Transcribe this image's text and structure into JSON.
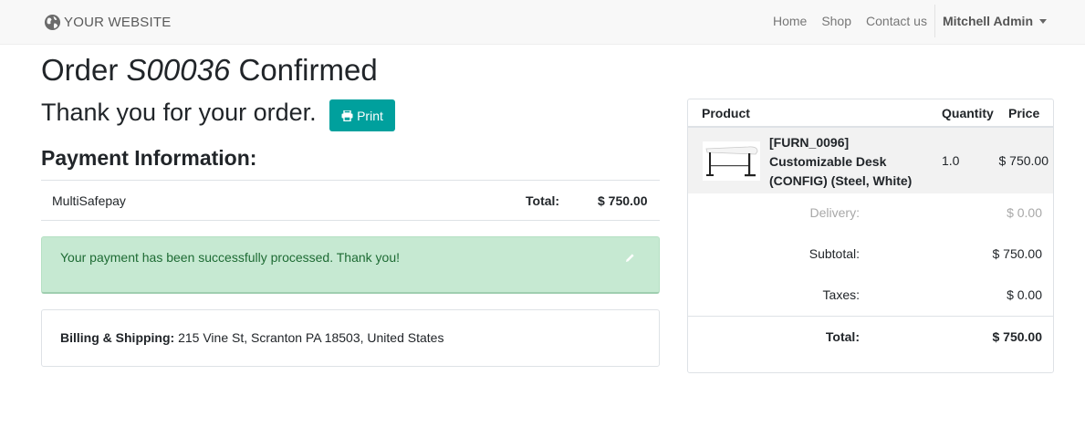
{
  "navbar": {
    "brand": "YOUR WEBSITE",
    "brand_icon": "globe-icon",
    "links": [
      "Home",
      "Shop",
      "Contact us"
    ],
    "user": "Mitchell Admin"
  },
  "order": {
    "title_prefix": "Order ",
    "number": "S00036",
    "title_suffix": " Confirmed",
    "thank_you": "Thank you for your order.",
    "print_label": "Print"
  },
  "payment": {
    "heading": "Payment Information:",
    "method": "MultiSafepay",
    "total_label": "Total:",
    "total_value": "$ 750.00",
    "alert": "Your payment has been successfully processed. Thank you!"
  },
  "address": {
    "label": "Billing & Shipping:",
    "value": " 215 Vine St, Scranton PA 18503, United States"
  },
  "summary": {
    "headers": {
      "product": "Product",
      "quantity": "Quantity",
      "price": "Price"
    },
    "item": {
      "name": "[FURN_0096] Customizable Desk (CONFIG) (Steel, White)",
      "quantity": "1.0",
      "price": "$ 750.00"
    },
    "delivery_label": "Delivery:",
    "delivery_value": "$ 0.00",
    "subtotal_label": "Subtotal:",
    "subtotal_value": "$ 750.00",
    "taxes_label": "Taxes:",
    "taxes_value": "$ 0.00",
    "total_label": "Total:",
    "total_value": "$ 750.00"
  },
  "colors": {
    "primary": "#00a09d",
    "alert_bg": "#c6e9d2",
    "alert_text": "#1e6b34"
  }
}
